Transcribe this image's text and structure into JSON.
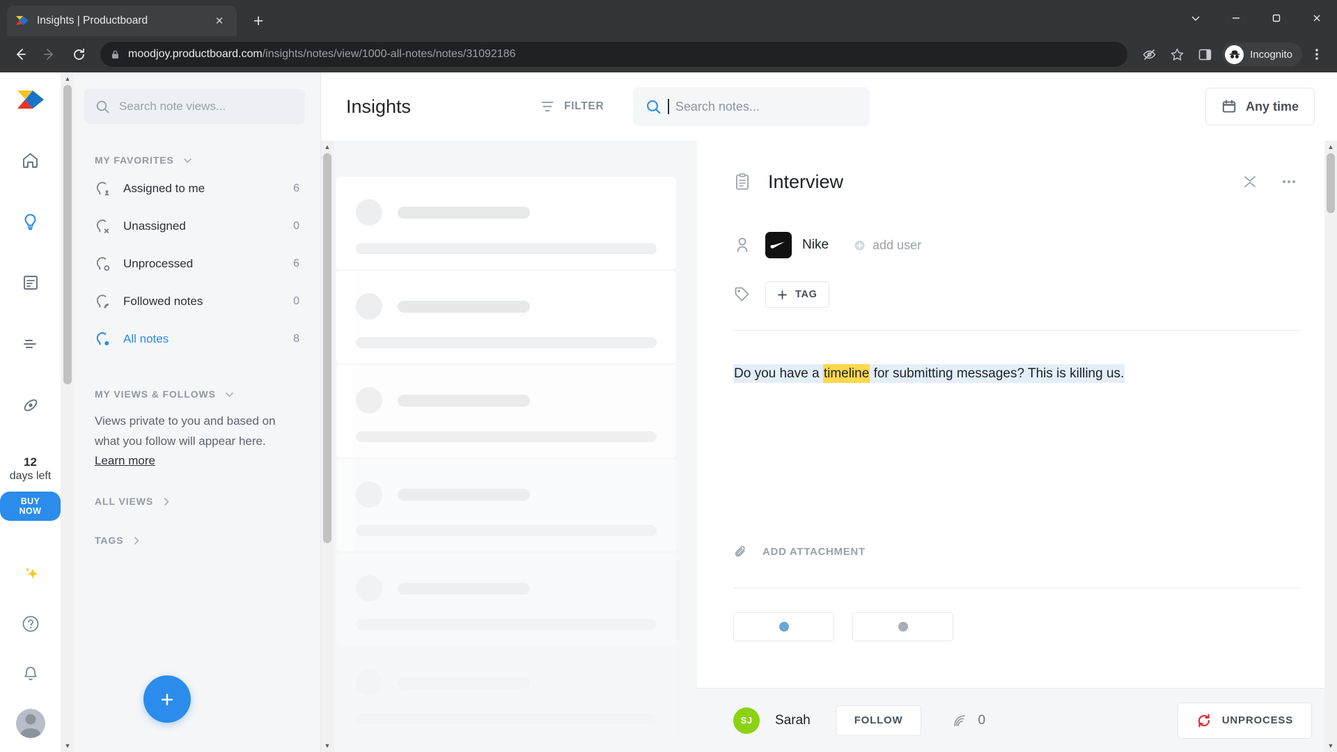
{
  "browser": {
    "tab": {
      "title": "Insights | Productboard",
      "favicon": "productboard-logo-icon",
      "close": "×"
    },
    "new_tab": "+",
    "window_controls": {
      "minimize_group": "chevron-down-icon",
      "minimize": "−",
      "maximize": "❐",
      "close": "✕"
    },
    "nav": {
      "back": "←",
      "forward": "→",
      "reload": "⟳"
    },
    "omnibox": {
      "lock": "lock-icon",
      "domain": "moodjoy.productboard.com",
      "path": "/insights/notes/view/1000-all-notes/notes/31092186",
      "full_url": "moodjoy.productboard.com/insights/notes/view/1000-all-notes/notes/31092186"
    },
    "actions": {
      "no_tracking": "eye-crossed-icon",
      "bookmark": "star-icon",
      "side_panel": "side-panel-icon",
      "menu": "kebab-menu-icon"
    },
    "profile": {
      "label": "Incognito",
      "icon": "incognito-icon"
    }
  },
  "rail": {
    "logo": "productboard-logo",
    "icons": [
      {
        "name": "home-icon",
        "active": false
      },
      {
        "name": "lightbulb-insights-icon",
        "active": true
      },
      {
        "name": "document-icon",
        "active": false
      },
      {
        "name": "features-list-icon",
        "active": false
      },
      {
        "name": "portal-icon",
        "active": false
      }
    ],
    "trial": {
      "days": "12",
      "label": "days left",
      "cta": "BUY NOW"
    },
    "bottom_icons": [
      {
        "name": "sparkles-icon"
      },
      {
        "name": "help-circle-icon"
      },
      {
        "name": "bell-icon"
      }
    ],
    "user_avatar": "user-avatar"
  },
  "sidebar": {
    "search": {
      "placeholder": "Search note views...",
      "value": "",
      "icon": "search-icon"
    },
    "favorites": {
      "title": "MY FAVORITES",
      "chevron": "chevron-down-icon",
      "items": [
        {
          "label": "Assigned to me",
          "count": "6",
          "icon": "note-user-icon",
          "active": false
        },
        {
          "label": "Unassigned",
          "count": "0",
          "icon": "note-x-icon",
          "active": false
        },
        {
          "label": "Unprocessed",
          "count": "6",
          "icon": "note-circle-icon",
          "active": false
        },
        {
          "label": "Followed notes",
          "count": "0",
          "icon": "note-follow-icon",
          "active": false
        },
        {
          "label": "All notes",
          "count": "8",
          "icon": "note-dot-icon",
          "active": true
        }
      ]
    },
    "my_views": {
      "title": "MY VIEWS & FOLLOWS",
      "chevron": "chevron-down-icon",
      "blurb": "Views private to you and based on what you follow will appear here.",
      "learn_more": "Learn more"
    },
    "all_views": {
      "title": "ALL VIEWS",
      "chevron": "chevron-right-icon"
    },
    "tags": {
      "title": "TAGS",
      "chevron": "chevron-right-icon"
    },
    "add_button": "+"
  },
  "header": {
    "title": "Insights",
    "filter": {
      "label": "FILTER",
      "icon": "filter-icon"
    },
    "search_notes": {
      "placeholder": "Search notes...",
      "value": "",
      "icon": "search-icon",
      "focused": true
    },
    "any_time": {
      "label": "Any time",
      "icon": "calendar-icon"
    }
  },
  "notes_list": {
    "loading": true,
    "skeleton_count": 6
  },
  "note": {
    "type_icon": "clipboard-note-icon",
    "title": "Interview",
    "collapse_icon": "collapse-icon",
    "more_icon": "more-options-icon",
    "customer": {
      "icon": "person-icon",
      "company": "Nike",
      "company_logo": "nike-swoosh-logo",
      "add_user": {
        "label": "add user",
        "icon": "plus-circle-icon"
      }
    },
    "tags": {
      "icon": "tag-icon",
      "add_label": "TAG",
      "add_icon": "plus-icon"
    },
    "content": {
      "before": "Do you have a ",
      "highlight": "timeline",
      "after": " for submitting messages? This is killing us.",
      "highlight_color": "#ffd84d",
      "selection_color": "#e4eefb"
    },
    "attachment": {
      "label": "ADD ATTACHMENT",
      "icon": "paperclip-icon"
    },
    "footer": {
      "author_initials": "SJ",
      "author_name": "Sarah",
      "follow_label": "FOLLOW",
      "impact_icon": "impact-signal-icon",
      "impact_value": "0",
      "unprocess_label": "UNPROCESS",
      "unprocess_icon": "unprocess-refresh-icon",
      "unprocess_color": "#e3262f"
    }
  },
  "colors": {
    "accent": "#2b8ceb",
    "chrome_bg": "#323639",
    "app_bg": "#f4f6f8",
    "highlight": "#ffd84d",
    "selection": "#e4eefb",
    "avatar_green": "#8cd211",
    "danger": "#e3262f"
  }
}
